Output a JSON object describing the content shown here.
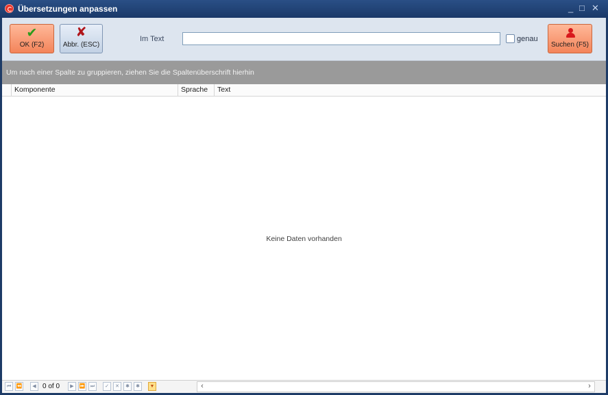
{
  "window": {
    "title": "Übersetzungen anpassen",
    "controls": {
      "minimize": "_",
      "maximize": "□",
      "close": "✕"
    }
  },
  "toolbar": {
    "ok_label": "OK (F2)",
    "cancel_label": "Abbr. (ESC)",
    "search_label": "Suchen (F5)",
    "imtext_label": "Im Text",
    "imtext_value": "",
    "imtext_placeholder": "",
    "genau_label": "genau",
    "genau_checked": false
  },
  "grid": {
    "group_hint": "Um nach einer Spalte zu gruppieren, ziehen Sie die Spaltenüberschrift hierhin",
    "columns": [
      "Komponente",
      "Sprache",
      "Text"
    ],
    "rows": [],
    "empty_text": "Keine Daten vorhanden"
  },
  "navigator": {
    "page_info": "0 of 0"
  },
  "colors": {
    "title_bar": "#1d3b66",
    "accent_button": "#f3845a",
    "group_panel": "#9a9a9a"
  }
}
